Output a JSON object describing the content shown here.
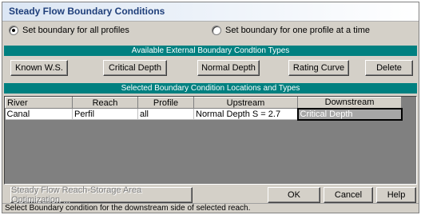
{
  "window": {
    "title": "Steady Flow Boundary Conditions"
  },
  "radio": {
    "all_profiles": {
      "label": "Set boundary for all profiles",
      "checked": true
    },
    "one_profile": {
      "label": "Set boundary for one profile at a time",
      "checked": false
    }
  },
  "sections": {
    "available_types": "Available External Boundary Condtion Types",
    "selected_locations": "Selected Boundary Condition Locations and Types"
  },
  "type_buttons": {
    "known_ws": "Known W.S.",
    "critical_depth": "Critical Depth",
    "normal_depth": "Normal Depth",
    "rating_curve": "Rating Curve",
    "delete": "Delete"
  },
  "table": {
    "columns": [
      "River",
      "Reach",
      "Profile",
      "Upstream",
      "Downstream"
    ],
    "rows": [
      {
        "river": "Canal",
        "reach": "Perfil",
        "profile": "all",
        "upstream": "Normal Depth S = 2.7",
        "downstream": "Critical Depth"
      }
    ]
  },
  "bottom_buttons": {
    "optimization": "Steady Flow Reach-Storage Area Optimization ...",
    "ok": "OK",
    "cancel": "Cancel",
    "help": "Help"
  },
  "status": "Select Boundary condition for the downstream side of selected reach.",
  "colors": {
    "section_bar": "#008080",
    "dialog_bg": "#d4d0c8",
    "selected_cell": "#a6a6a6"
  }
}
